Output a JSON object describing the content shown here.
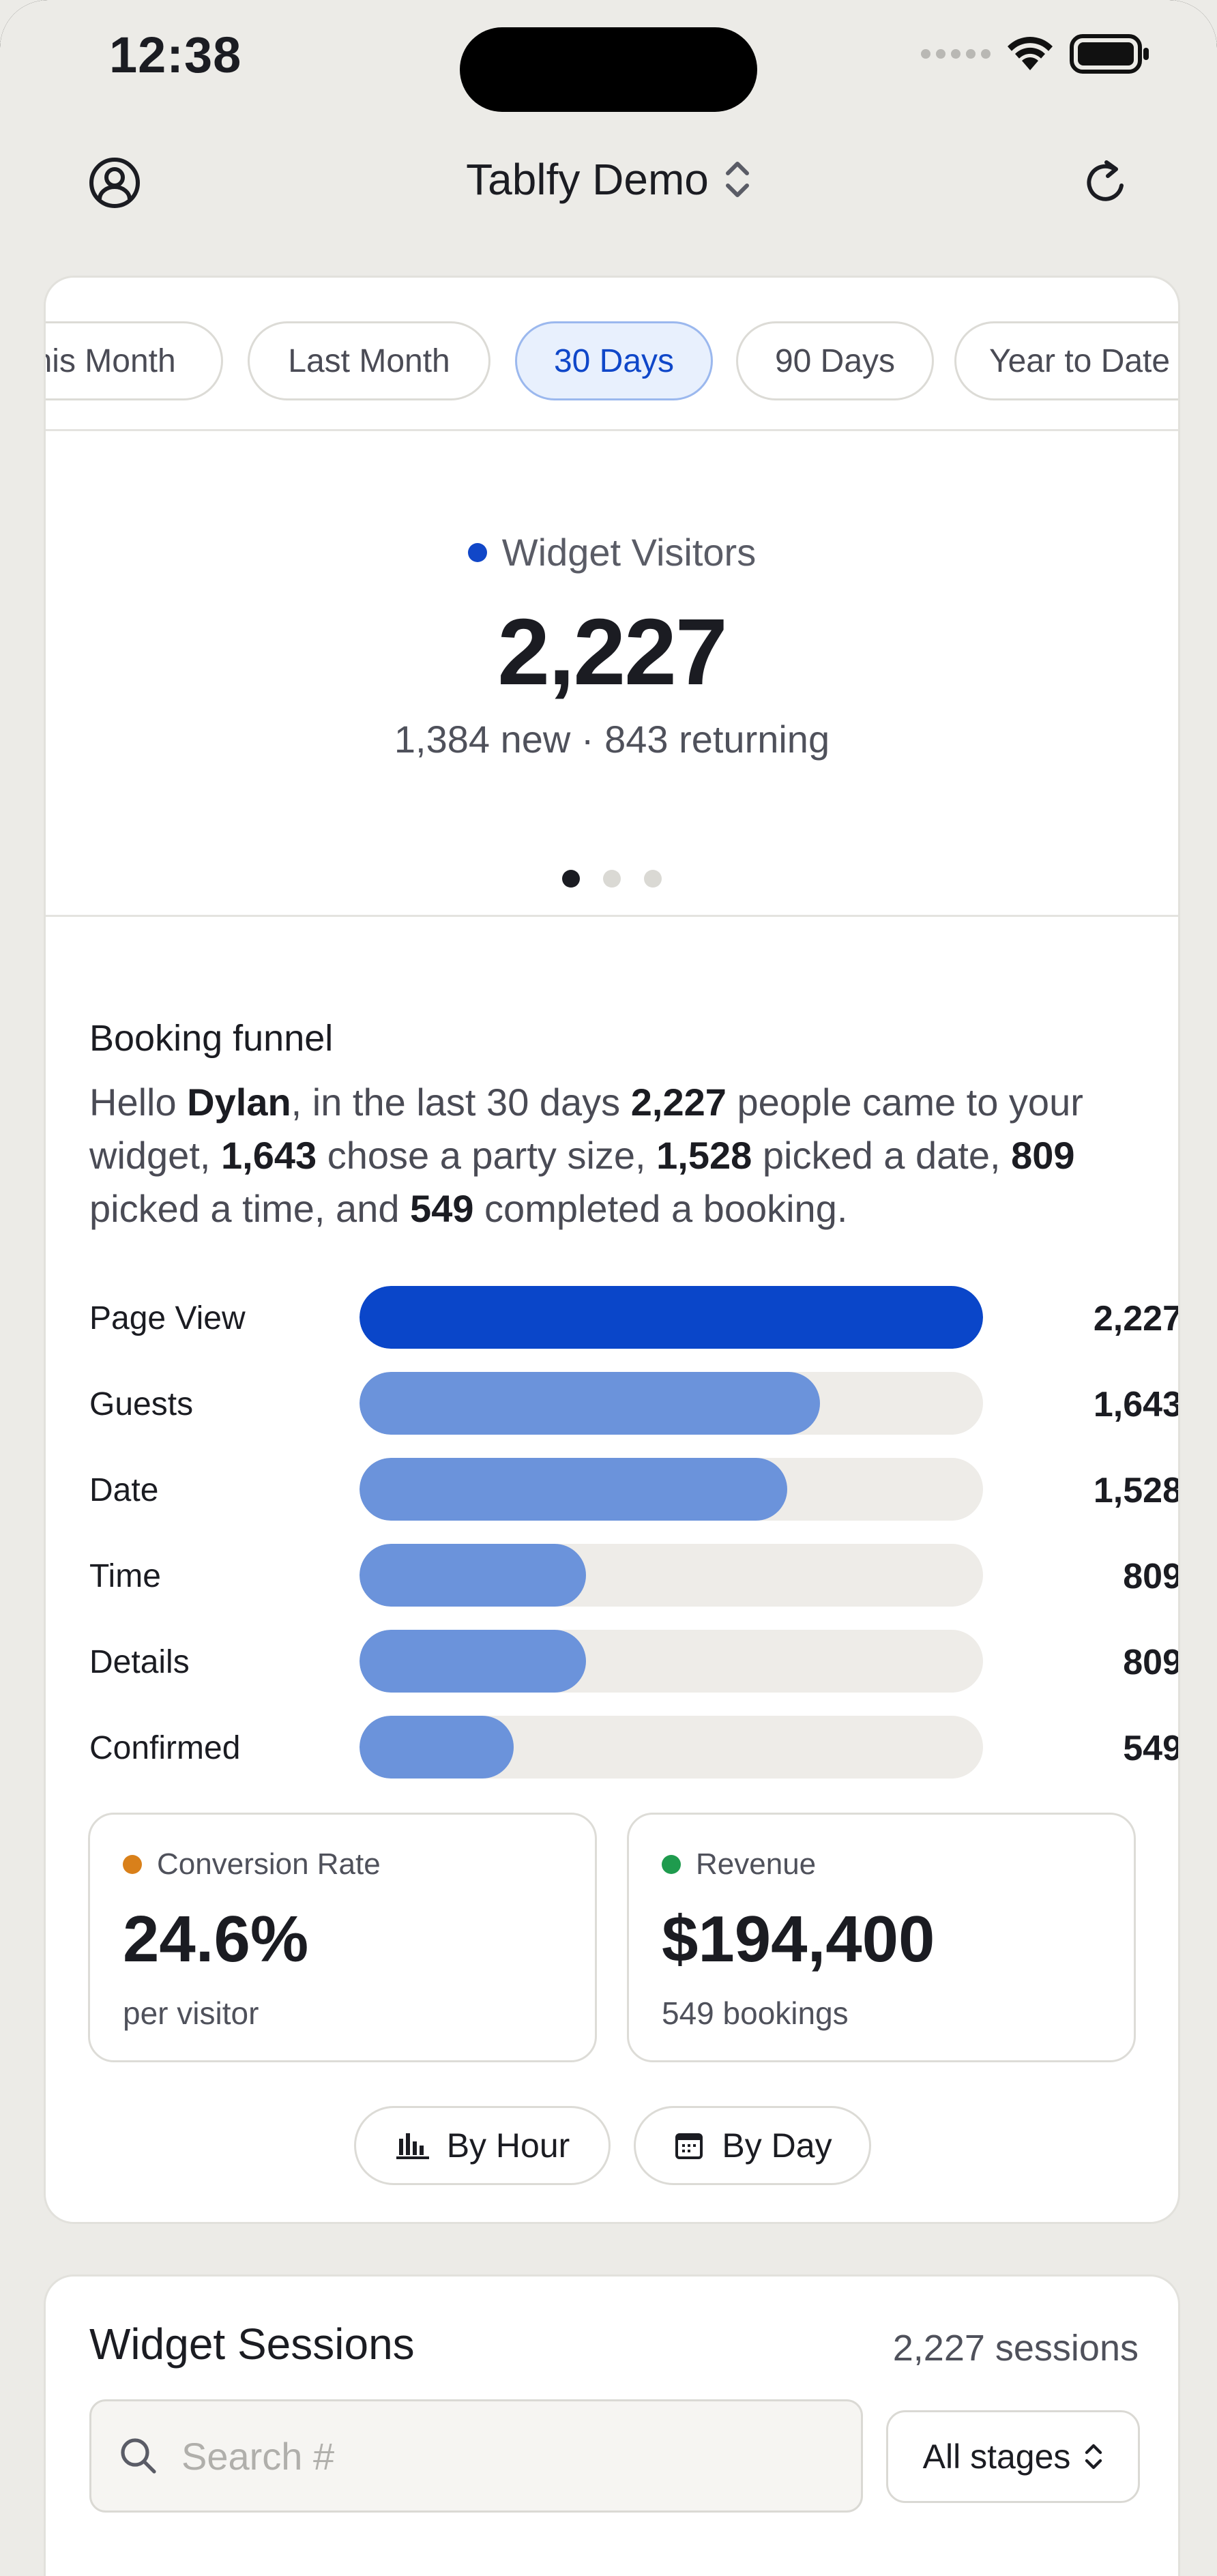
{
  "status_bar": {
    "time": "12:38"
  },
  "header": {
    "title": "Tablfy Demo"
  },
  "range_tabs": [
    {
      "label": "This Month",
      "active": false
    },
    {
      "label": "Last Month",
      "active": false
    },
    {
      "label": "30 Days",
      "active": true
    },
    {
      "label": "90 Days",
      "active": false
    },
    {
      "label": "Year to Date",
      "active": false
    }
  ],
  "kpi": {
    "label": "Widget Visitors",
    "value": "2,227",
    "sub": "1,384 new · 843 returning",
    "accent": "#1147C8",
    "page_index": 0,
    "page_count": 3
  },
  "funnel": {
    "title": "Booking funnel",
    "summary": {
      "p1": "Hello ",
      "name": "Dylan",
      "p2": ", in the last 30 days ",
      "n1": "2,227",
      "p3": " people came to your widget, ",
      "n2": "1,643",
      "p4": " chose a party size, ",
      "n3": "1,528",
      "p5": " picked a date, ",
      "n4": "809",
      "p6": " picked a time, and ",
      "n5": "549",
      "p7": " completed a booking."
    },
    "steps": [
      {
        "label": "Page View",
        "value": "2,227",
        "fraction": 1.0
      },
      {
        "label": "Guests",
        "value": "1,643",
        "fraction": 0.738
      },
      {
        "label": "Date",
        "value": "1,528",
        "fraction": 0.686
      },
      {
        "label": "Time",
        "value": "809",
        "fraction": 0.363
      },
      {
        "label": "Details",
        "value": "809",
        "fraction": 0.363
      },
      {
        "label": "Confirmed",
        "value": "549",
        "fraction": 0.247
      }
    ]
  },
  "stats": {
    "conversion": {
      "label": "Conversion Rate",
      "value": "24.6%",
      "sub": "per visitor",
      "color": "#D9801A"
    },
    "revenue": {
      "label": "Revenue",
      "value": "$194,400",
      "sub": "549 bookings",
      "color": "#1F9B4E"
    }
  },
  "view_buttons": {
    "by_hour": "By Hour",
    "by_day": "By Day"
  },
  "sessions": {
    "title": "Widget Sessions",
    "count": "2,227 sessions",
    "search_placeholder": "Search #",
    "search_value": "",
    "stage_filter": "All stages"
  }
}
